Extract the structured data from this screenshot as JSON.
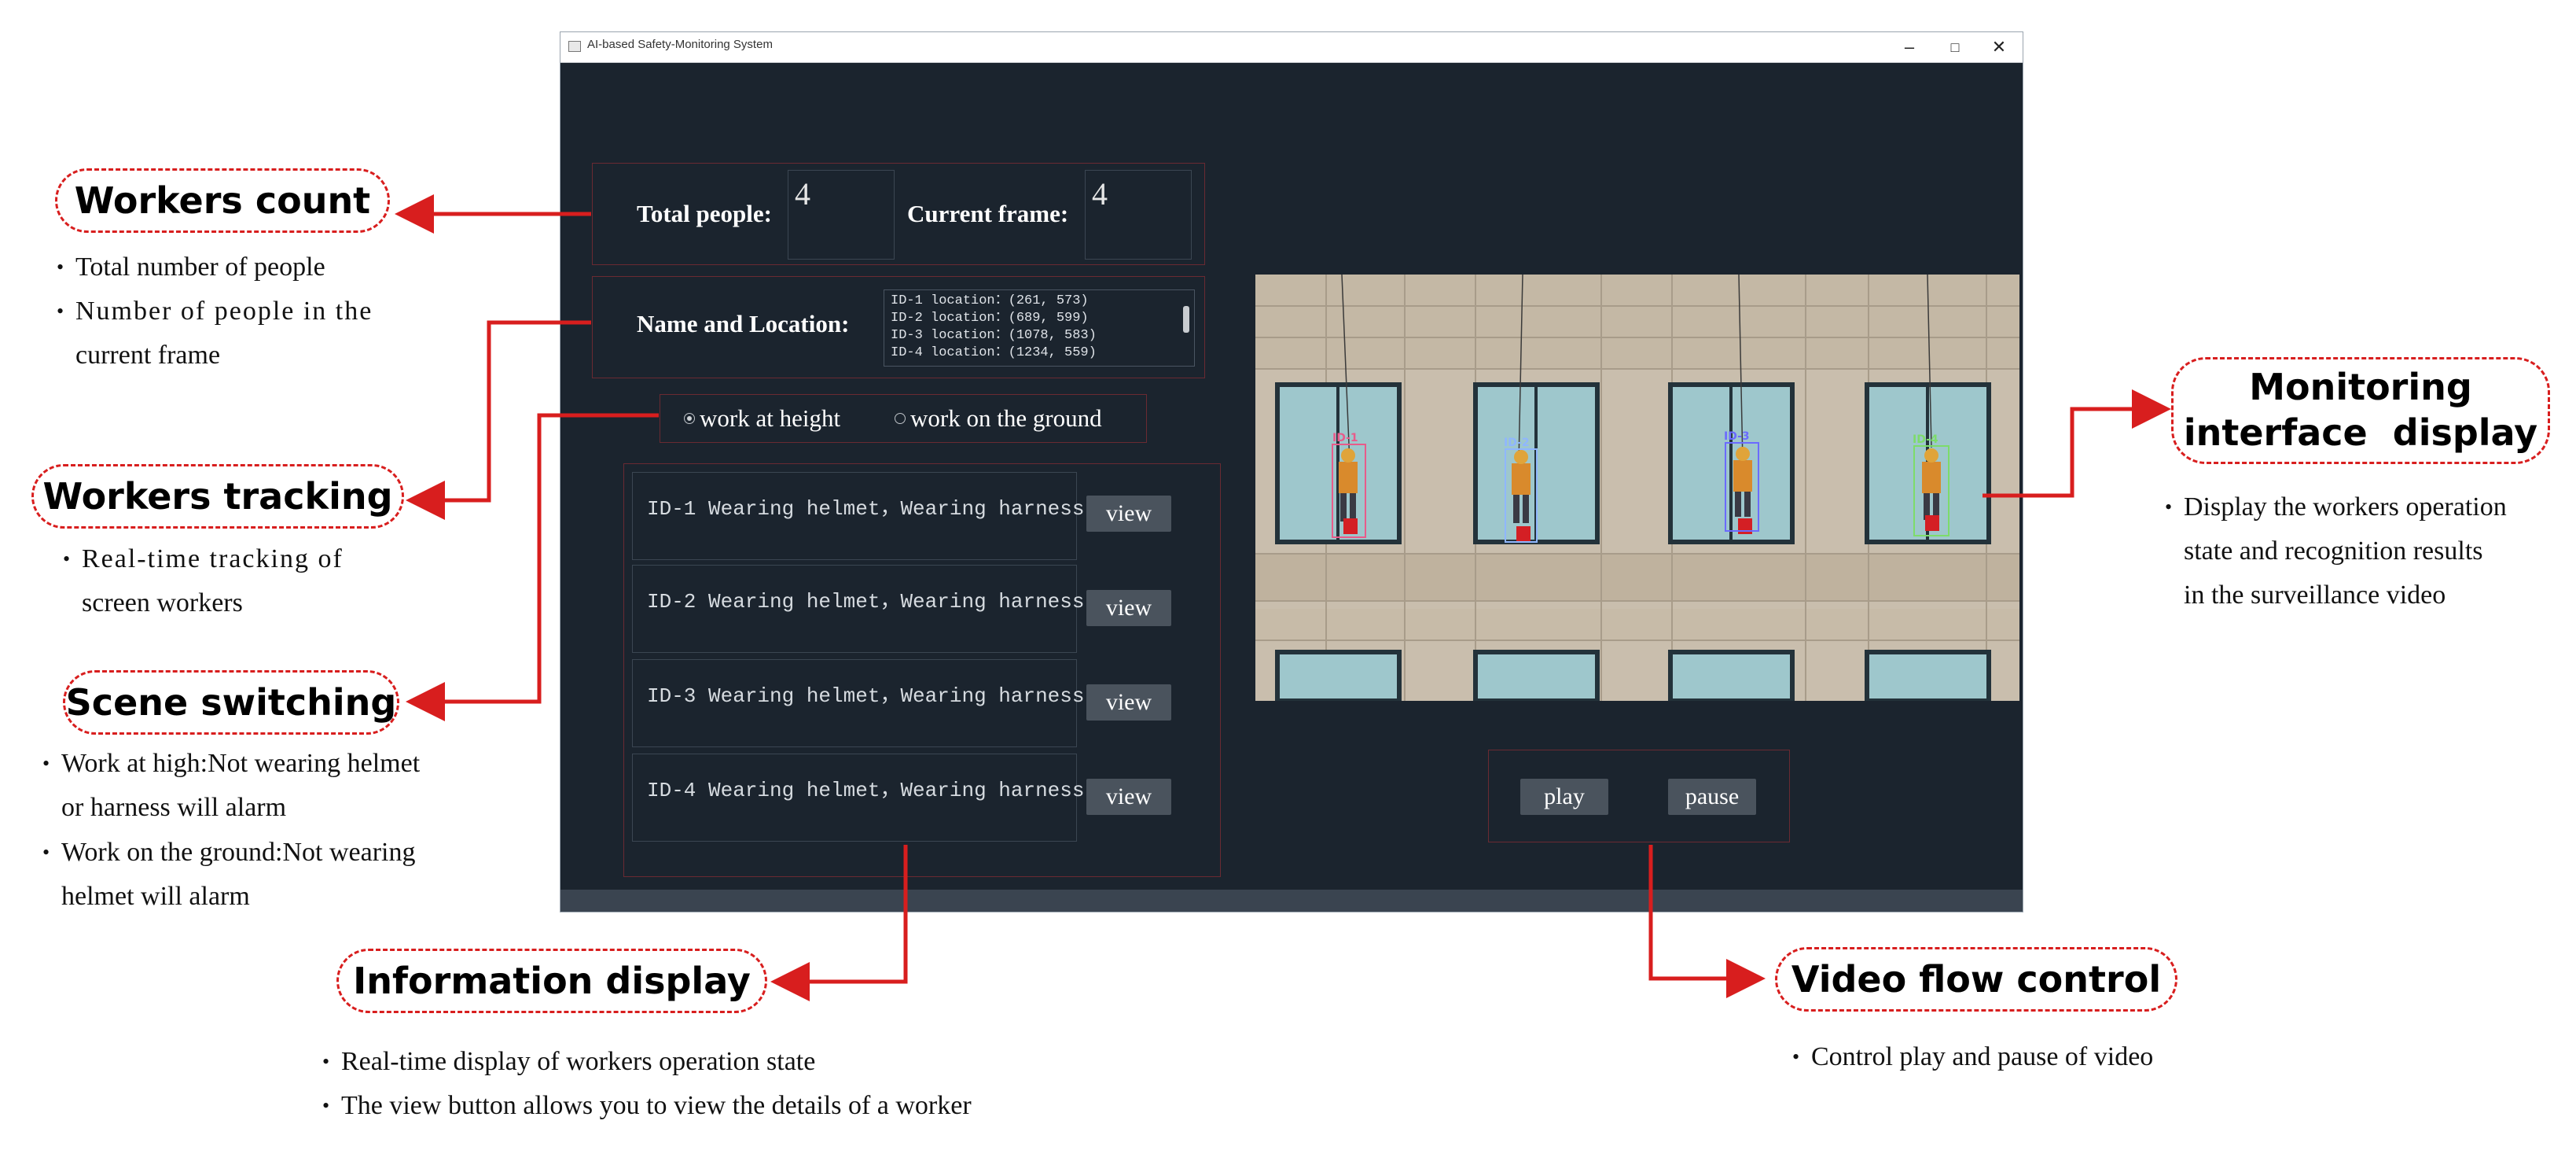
{
  "window": {
    "title": "AI-based Safety-Monitoring System",
    "controls": {
      "minimize": "–",
      "maximize": "□",
      "close": "✕"
    }
  },
  "app": {
    "total_people_label": "Total people:",
    "total_people_value": "4",
    "current_frame_label": "Current frame:",
    "current_frame_value": "4",
    "name_location_label": "Name and Location:",
    "locations": [
      "ID-1 location：(261, 573)",
      "ID-2 location：(689, 599)",
      "ID-3 location：(1078, 583)",
      "ID-4 location：(1234, 559)"
    ],
    "scene_options": [
      {
        "label": "work at height",
        "selected": true
      },
      {
        "label": "work on the ground",
        "selected": false
      }
    ],
    "workers": [
      {
        "text": "ID-1 Wearing helmet，Wearing harness",
        "button": "view"
      },
      {
        "text": "ID-2 Wearing helmet，Wearing harness",
        "button": "view"
      },
      {
        "text": "ID-3 Wearing helmet，Wearing harness",
        "button": "view"
      },
      {
        "text": "ID-4 Wearing helmet，Wearing harness",
        "button": "view"
      }
    ],
    "play_label": "play",
    "pause_label": "pause",
    "detections": [
      "ID-1",
      "ID-2",
      "ID-3",
      "ID-4"
    ]
  },
  "annotations": {
    "workers_count": {
      "title": "Workers count",
      "bullets": [
        "Total number of people",
        "Number of people in the",
        "current frame"
      ]
    },
    "workers_tracking": {
      "title": "Workers tracking",
      "bullets": [
        "Real-time tracking of",
        "screen workers"
      ]
    },
    "scene_switching": {
      "title": "Scene switching",
      "bullets": [
        "Work at high:Not wearing helmet",
        "or harness will alarm",
        "Work on the ground:Not wearing",
        "helmet will alarm"
      ]
    },
    "information_display": {
      "title": "Information display",
      "bullets": [
        "Real-time display of workers operation state",
        "The view button allows you to view the details of a worker"
      ]
    },
    "monitoring_display": {
      "title_line1": "Monitoring",
      "title_line2": "interface  display",
      "bullets": [
        "Display the workers operation",
        "state and recognition results",
        "in the surveillance video"
      ]
    },
    "video_flow_control": {
      "title": "Video flow control",
      "bullets": [
        "Control play and pause of video"
      ]
    }
  },
  "colors": {
    "accent": "#d81e1e",
    "window_bg": "#1b242e",
    "button_bg": "#4a535d"
  }
}
